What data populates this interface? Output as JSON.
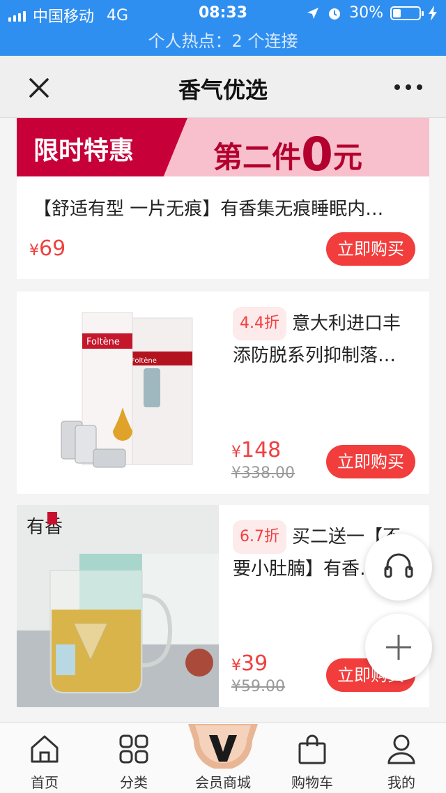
{
  "status_bar": {
    "carrier": "中国移动",
    "network": "4G",
    "time": "08:33",
    "battery": "30%",
    "battery_level": 0.3
  },
  "hotspot_text": "个人热点：2 个连接",
  "header": {
    "title": "香气优选"
  },
  "banner": {
    "tag": "限时特惠",
    "promo_prefix": "第二件",
    "promo_number": "0",
    "promo_suffix": "元"
  },
  "products": [
    {
      "name": "【舒适有型 一片无痕】有香集无痕睡眠内…",
      "price": "69",
      "buy_label": "立即购买"
    },
    {
      "discount": "4.4折",
      "name": "意大利进口丰添防脱系列抑制落…",
      "price": "148",
      "old_price": "¥338.00",
      "buy_label": "立即购买",
      "image_text": "Foltène"
    },
    {
      "discount": "6.7折",
      "name": "买二送一【不要小肚腩】有香…",
      "price": "39",
      "old_price": "¥59.00",
      "buy_label": "立即购买",
      "image_text": "有香"
    }
  ],
  "currency_symbol": "¥",
  "tabs": [
    {
      "label": "首页",
      "icon": "home-icon"
    },
    {
      "label": "分类",
      "icon": "grid-icon"
    },
    {
      "label": "会员商城",
      "icon": "vip-v-icon"
    },
    {
      "label": "购物车",
      "icon": "bag-icon"
    },
    {
      "label": "我的",
      "icon": "user-icon"
    }
  ],
  "colors": {
    "status_bar": "#2f8ff0",
    "accent_red": "#f23d3d",
    "banner_tag": "#c8003a",
    "banner_bg": "#f7c0cc"
  }
}
